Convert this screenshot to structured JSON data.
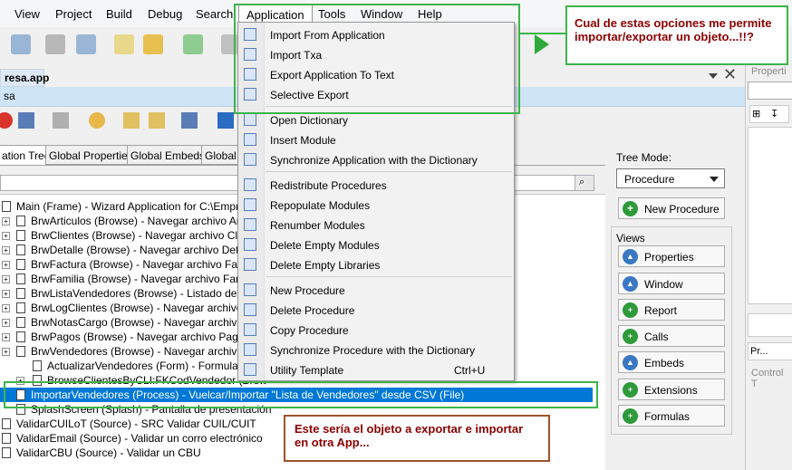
{
  "menubar": {
    "items": [
      "View",
      "Project",
      "Build",
      "Debug",
      "Search",
      "Application",
      "Tools",
      "Window",
      "Help"
    ]
  },
  "doc_tab": {
    "title": "resa.app"
  },
  "infobar": {
    "text": "sa"
  },
  "tabs": [
    "ation Tree",
    "Global Properties",
    "Global Embeds",
    "Global E"
  ],
  "tree": {
    "rows": [
      "Main (Frame) - Wizard Application for C:\\Empresa\\DC",
      "BrwArticulos (Browse) - Navegar archivo Articulo",
      "BrwClientes (Browse) - Navegar archivo Clientes",
      "BrwDetalle (Browse) - Navegar archivo Detalle",
      "BrwFactura (Browse) - Navegar archivo Factura",
      "BrwFamilia (Browse) - Navegar archivo Familia",
      "BrwListaVendedores (Browse) - Listado de Lista\\",
      "BrwLogClientes (Browse) - Navegar archivo Log",
      "BrwNotasCargo (Browse) - Navegar archivo Nota",
      "BrwPagos (Browse) - Navegar archivo Pagos",
      "BrwVendedores (Browse) - Navegar archivo Ven",
      "ActualizarVendedores (Form) - Formulario Ver",
      "BrowseClientesByCLI:FKCodVendedor (Brow",
      "ImportarVendedores (Process) - Vuelcar/Importar \"Lista de Vendedores\" desde CSV (File)",
      "SplashScreen (Splash) - Pantalla de presentación",
      "ValidarCUILoT (Source) - SRC Validar CUIL/CUIT",
      "ValidarEmail (Source) - Validar un corro electrónico",
      "ValidarCBU (Source) - Validar un CBU"
    ]
  },
  "right_panel": {
    "tree_mode_label": "Tree Mode:",
    "tree_mode_value": "Procedure",
    "new_procedure": "New Procedure",
    "views_label": "Views",
    "views": [
      "Properties",
      "Window",
      "Report",
      "Calls",
      "Embeds",
      "Extensions",
      "Formulas"
    ]
  },
  "far_right": {
    "properties_label": "Properti",
    "pr_tab": "Pr...",
    "control_label": "Control T"
  },
  "dropdown": {
    "items": [
      {
        "label": "Import From Application",
        "shortcut": ""
      },
      {
        "label": "Import Txa",
        "shortcut": ""
      },
      {
        "label": "Export Application To Text",
        "shortcut": ""
      },
      {
        "label": "Selective Export",
        "shortcut": ""
      },
      {
        "label": "Open Dictionary",
        "shortcut": ""
      },
      {
        "label": "Insert Module",
        "shortcut": ""
      },
      {
        "label": "Synchronize Application with the Dictionary",
        "shortcut": ""
      },
      {
        "label": "Redistribute Procedures",
        "shortcut": ""
      },
      {
        "label": "Repopulate Modules",
        "shortcut": ""
      },
      {
        "label": "Renumber Modules",
        "shortcut": ""
      },
      {
        "label": "Delete Empty Modules",
        "shortcut": ""
      },
      {
        "label": "Delete Empty Libraries",
        "shortcut": ""
      },
      {
        "label": "New Procedure",
        "shortcut": ""
      },
      {
        "label": "Delete Procedure",
        "shortcut": ""
      },
      {
        "label": "Copy Procedure",
        "shortcut": ""
      },
      {
        "label": "Synchronize Procedure with the Dictionary",
        "shortcut": ""
      },
      {
        "label": "Utility Template",
        "shortcut": "Ctrl+U"
      }
    ]
  },
  "annotations": {
    "note1": "Cual de estas opciones me permite importar/exportar un objeto...!!?",
    "note2": "Este sería el objeto a exportar e importar en otra App..."
  },
  "colors": {
    "accent": "#0078d7",
    "annotation_green": "#3cb54a",
    "annotation_text": "#8b0000"
  }
}
